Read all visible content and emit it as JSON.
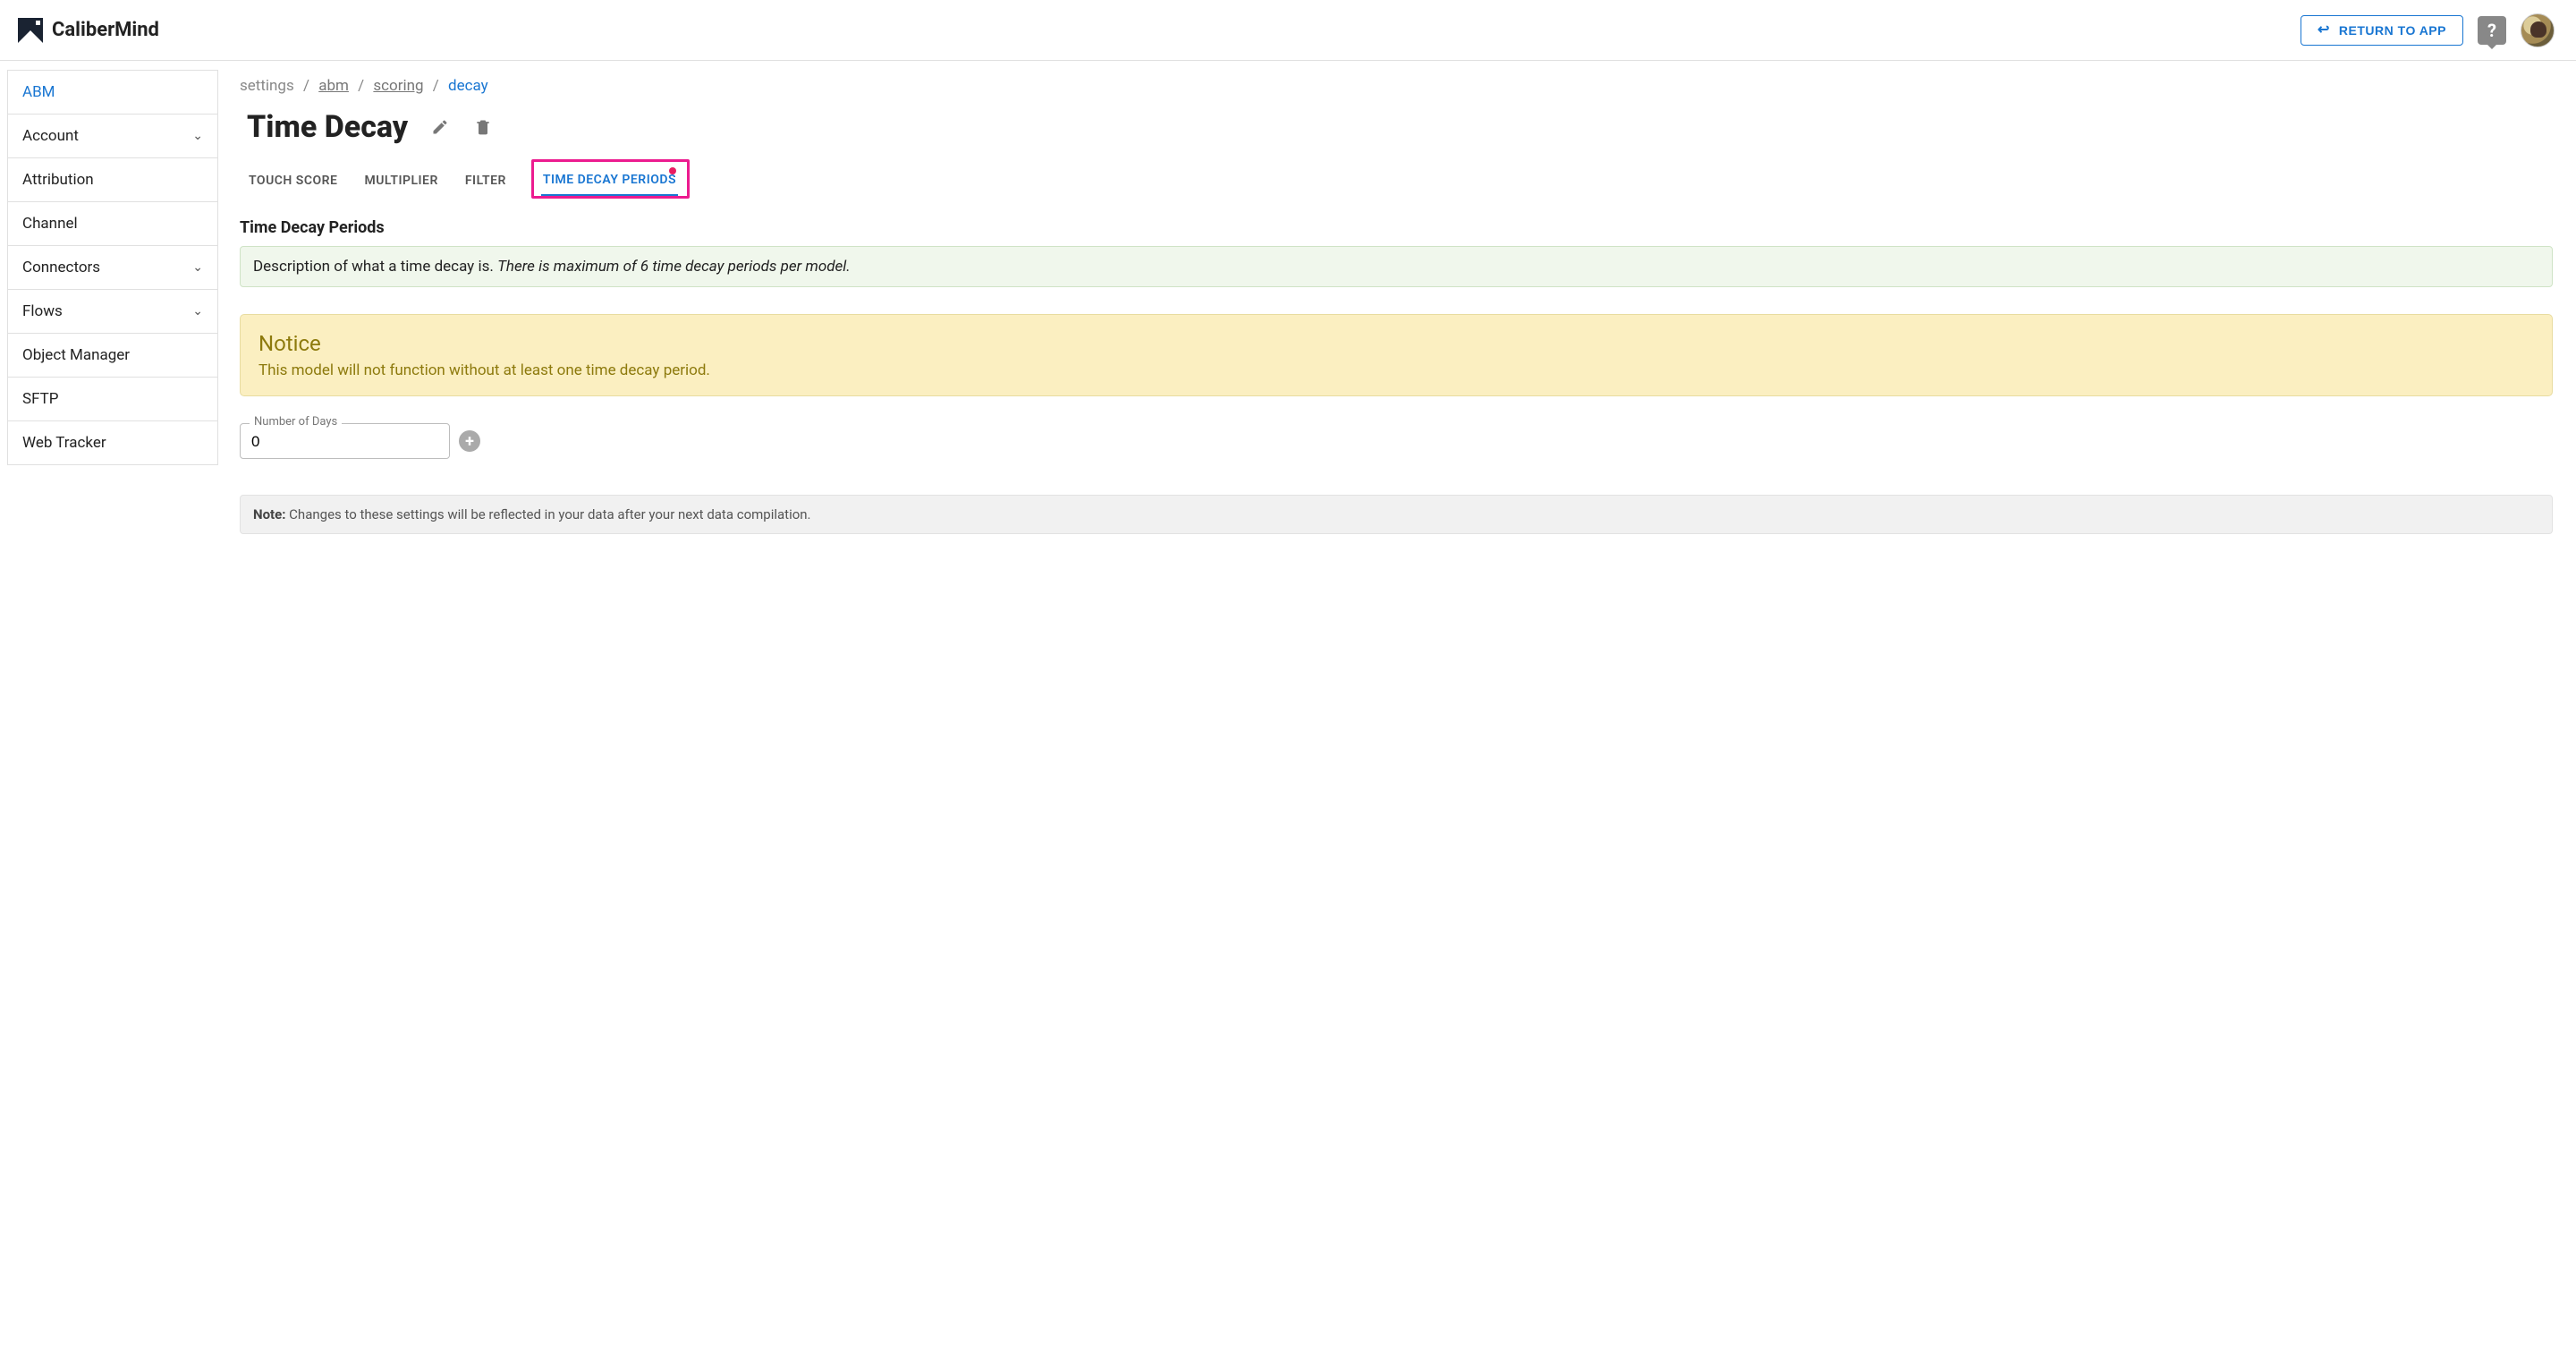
{
  "header": {
    "brand": "CaliberMind",
    "return_label": "RETURN TO APP",
    "help_label": "?",
    "return_arrow": "↩"
  },
  "sidebar": {
    "items": [
      {
        "label": "ABM",
        "active": true,
        "expandable": false
      },
      {
        "label": "Account",
        "active": false,
        "expandable": true
      },
      {
        "label": "Attribution",
        "active": false,
        "expandable": false
      },
      {
        "label": "Channel",
        "active": false,
        "expandable": false
      },
      {
        "label": "Connectors",
        "active": false,
        "expandable": true
      },
      {
        "label": "Flows",
        "active": false,
        "expandable": true
      },
      {
        "label": "Object Manager",
        "active": false,
        "expandable": false
      },
      {
        "label": "SFTP",
        "active": false,
        "expandable": false
      },
      {
        "label": "Web Tracker",
        "active": false,
        "expandable": false
      }
    ]
  },
  "breadcrumb": {
    "items": [
      {
        "label": "settings",
        "type": "plain"
      },
      {
        "label": "abm",
        "type": "link"
      },
      {
        "label": "scoring",
        "type": "link"
      },
      {
        "label": "decay",
        "type": "current"
      }
    ],
    "separator": "/"
  },
  "page": {
    "title": "Time Decay"
  },
  "tabs": [
    {
      "label": "TOUCH SCORE",
      "active": false
    },
    {
      "label": "MULTIPLIER",
      "active": false
    },
    {
      "label": "FILTER",
      "active": false
    },
    {
      "label": "TIME DECAY PERIODS",
      "active": true
    }
  ],
  "section": {
    "title": "Time Decay Periods",
    "description_prefix": "Description of what a time decay is. ",
    "description_emph": "There is maximum of 6 time decay periods per model."
  },
  "notice": {
    "title": "Notice",
    "text": "This model will not function without at least one time decay period."
  },
  "form": {
    "days_label": "Number of Days",
    "days_value": "0",
    "add_symbol": "+"
  },
  "footer_note": {
    "prefix": "Note:",
    "text": " Changes to these settings will be reflected in your data after your next data compilation."
  }
}
